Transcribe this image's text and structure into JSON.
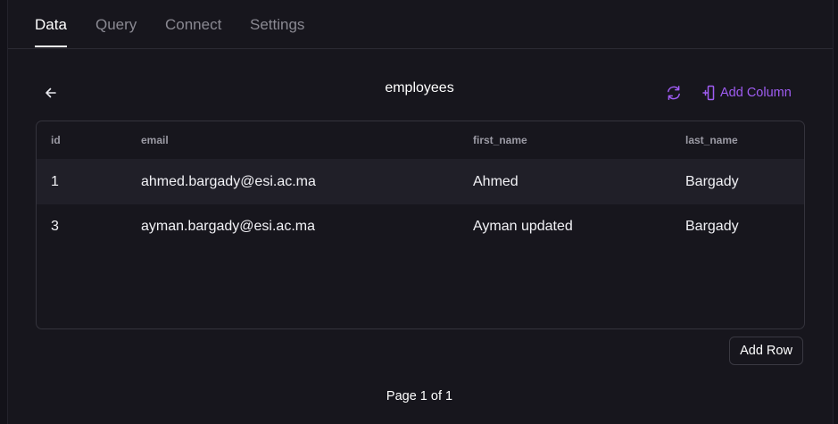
{
  "tabs": [
    {
      "label": "Data",
      "active": true
    },
    {
      "label": "Query",
      "active": false
    },
    {
      "label": "Connect",
      "active": false
    },
    {
      "label": "Settings",
      "active": false
    }
  ],
  "toolbar": {
    "back_icon": "arrow-left-icon",
    "title": "employees",
    "refresh_icon": "refresh-icon",
    "add_column_icon": "add-column-icon",
    "add_column_label": "Add Column"
  },
  "table": {
    "columns": [
      "id",
      "email",
      "first_name",
      "last_name"
    ],
    "rows": [
      [
        "1",
        "ahmed.bargady@esi.ac.ma",
        "Ahmed",
        "Bargady"
      ],
      [
        "3",
        "ayman.bargady@esi.ac.ma",
        "Ayman updated",
        "Bargady"
      ]
    ]
  },
  "actions": {
    "add_row_label": "Add Row"
  },
  "pagination": {
    "label": "Page 1 of 1"
  },
  "colors": {
    "accent": "#9f5cf2",
    "background": "#17161d",
    "row_highlight": "#201f28"
  }
}
